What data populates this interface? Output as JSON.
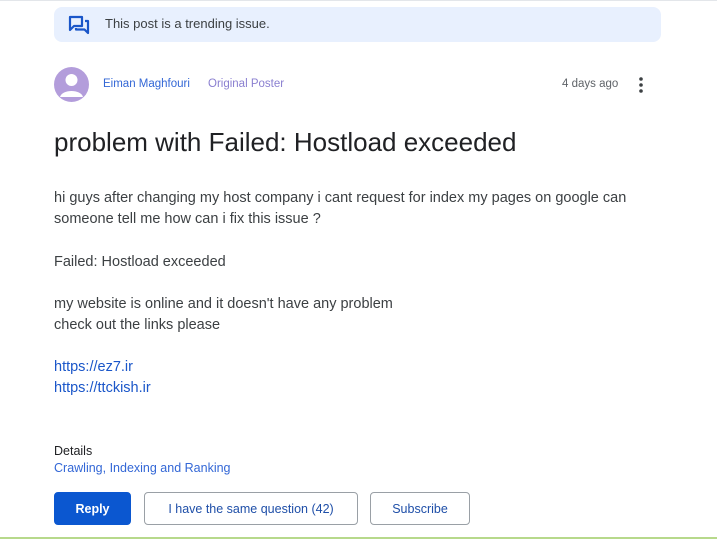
{
  "banner": {
    "text": "This post is a trending issue.",
    "icon": "forum-icon"
  },
  "post": {
    "author": "Eiman Maghfouri",
    "role": "Original Poster",
    "time": "4 days ago",
    "title": "problem with Failed: Hostload exceeded",
    "body_lines": [
      "hi guys after changing my host company i cant request for index my pages on google can",
      "someone tell me how can i fix this issue ?",
      "Failed: Hostload exceeded",
      "my website is online and it doesn't have any problem",
      "check out the links please"
    ],
    "links": [
      "https://ez7.ir",
      "https://ttckish.ir"
    ]
  },
  "details": {
    "label": "Details",
    "category": "Crawling, Indexing and Ranking"
  },
  "actions": {
    "reply": "Reply",
    "same_question": "I have the same question (42)",
    "subscribe": "Subscribe"
  },
  "colors": {
    "banner_bg": "#e8f0fe",
    "primary": "#0b57d0",
    "link": "#1a56c9",
    "avatar": "#b39ddb"
  }
}
